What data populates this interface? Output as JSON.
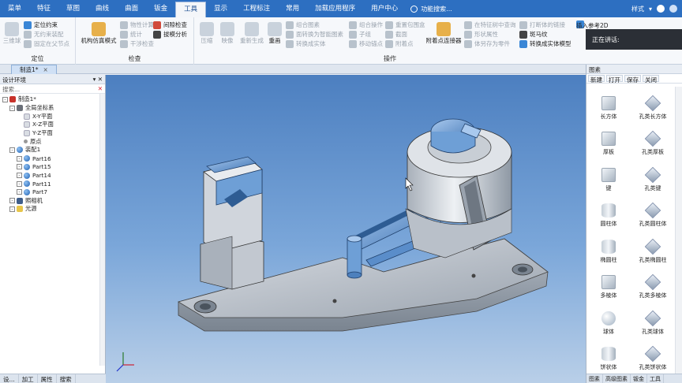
{
  "menu": {
    "tabs": [
      "菜单",
      "特征",
      "草图",
      "曲线",
      "曲面",
      "钣金",
      "工具",
      "显示",
      "工程标注",
      "常用",
      "加载应用程序",
      "用户中心"
    ],
    "active_index": 6,
    "search_placeholder": "功能搜索...",
    "style_label": "样式"
  },
  "ribbon": {
    "group_position": {
      "title": "定位",
      "big": "三维球",
      "items": [
        "定位约束",
        "无约束装配",
        "固定在父节点"
      ]
    },
    "group_check": {
      "title": "检查",
      "big": "机构仿真模式",
      "items": [
        "物性计算",
        "统计",
        "干涉检查",
        "间隙检查",
        "拔模分析"
      ]
    },
    "group_ops": {
      "title": "操作",
      "bigs": [
        "压缩",
        "映像",
        "重新生成",
        "重画"
      ],
      "items": [
        "组合图素",
        "面转换为智能图素",
        "转换成实体",
        "组合操作",
        "子组",
        "移动锚点",
        "重置包围盒",
        "截面",
        "附着点",
        "附着点连接器",
        "在特征树中查询",
        "形状属性",
        "体另存为零件",
        "打断体的链接",
        "斑马纹",
        "转换成实体模型",
        "插入参考2D"
      ]
    },
    "presenter_text": "正在讲话:"
  },
  "document": {
    "tab_label": "制造1*"
  },
  "left_panel": {
    "title": "设计环境",
    "search_placeholder": "搜索...",
    "tree": [
      {
        "label": "制造1*",
        "level": 0,
        "icon": "red"
      },
      {
        "label": "全局坐标系",
        "level": 1,
        "icon": "ax"
      },
      {
        "label": "X-Y平面",
        "level": 2,
        "icon": "pl"
      },
      {
        "label": "X-Z平面",
        "level": 2,
        "icon": "pl"
      },
      {
        "label": "Y-Z平面",
        "level": 2,
        "icon": "pl"
      },
      {
        "label": "原点",
        "level": 2,
        "icon": "pt"
      },
      {
        "label": "装配1",
        "level": 1,
        "icon": "ball"
      },
      {
        "label": "Part16",
        "level": 2,
        "icon": "ball"
      },
      {
        "label": "Part15",
        "level": 2,
        "icon": "ball"
      },
      {
        "label": "Part14",
        "level": 2,
        "icon": "ball"
      },
      {
        "label": "Part11",
        "level": 2,
        "icon": "ball"
      },
      {
        "label": "Part7",
        "level": 2,
        "icon": "ball"
      },
      {
        "label": "照相机",
        "level": 1,
        "icon": "grp"
      },
      {
        "label": "光源",
        "level": 1,
        "icon": "lite"
      }
    ],
    "bottom_tabs": [
      "设...",
      "加工",
      "属性",
      "搜索"
    ]
  },
  "right_panel": {
    "title": "图素",
    "toolbar": [
      "新建",
      "打开",
      "保存",
      "关闭"
    ],
    "items": [
      {
        "label": "长方体",
        "shape": "solid"
      },
      {
        "label": "孔类长方体",
        "shape": "hole"
      },
      {
        "label": "厚板",
        "shape": "solid"
      },
      {
        "label": "孔类厚板",
        "shape": "hole"
      },
      {
        "label": "键",
        "shape": "solid"
      },
      {
        "label": "孔类键",
        "shape": "hole"
      },
      {
        "label": "圆柱体",
        "shape": "cyl"
      },
      {
        "label": "孔类圆柱体",
        "shape": "hole"
      },
      {
        "label": "椭圆柱",
        "shape": "cyl"
      },
      {
        "label": "孔类椭圆柱",
        "shape": "hole"
      },
      {
        "label": "多棱体",
        "shape": "solid"
      },
      {
        "label": "孔类多棱体",
        "shape": "hole"
      },
      {
        "label": "球体",
        "shape": "sph"
      },
      {
        "label": "孔类球体",
        "shape": "hole"
      },
      {
        "label": "饼状体",
        "shape": "cyl"
      },
      {
        "label": "孔类饼状体",
        "shape": "hole"
      }
    ],
    "bottom_tabs": [
      "图素",
      "高级图素",
      "钣金",
      "工具"
    ]
  },
  "colors": {
    "menu_bg": "#2d6fc1",
    "viewport_top": "#4c7fc0",
    "viewport_bottom": "#b9cfe8",
    "part_gray": "#c9ced6",
    "part_blue": "#6e9fd6"
  }
}
